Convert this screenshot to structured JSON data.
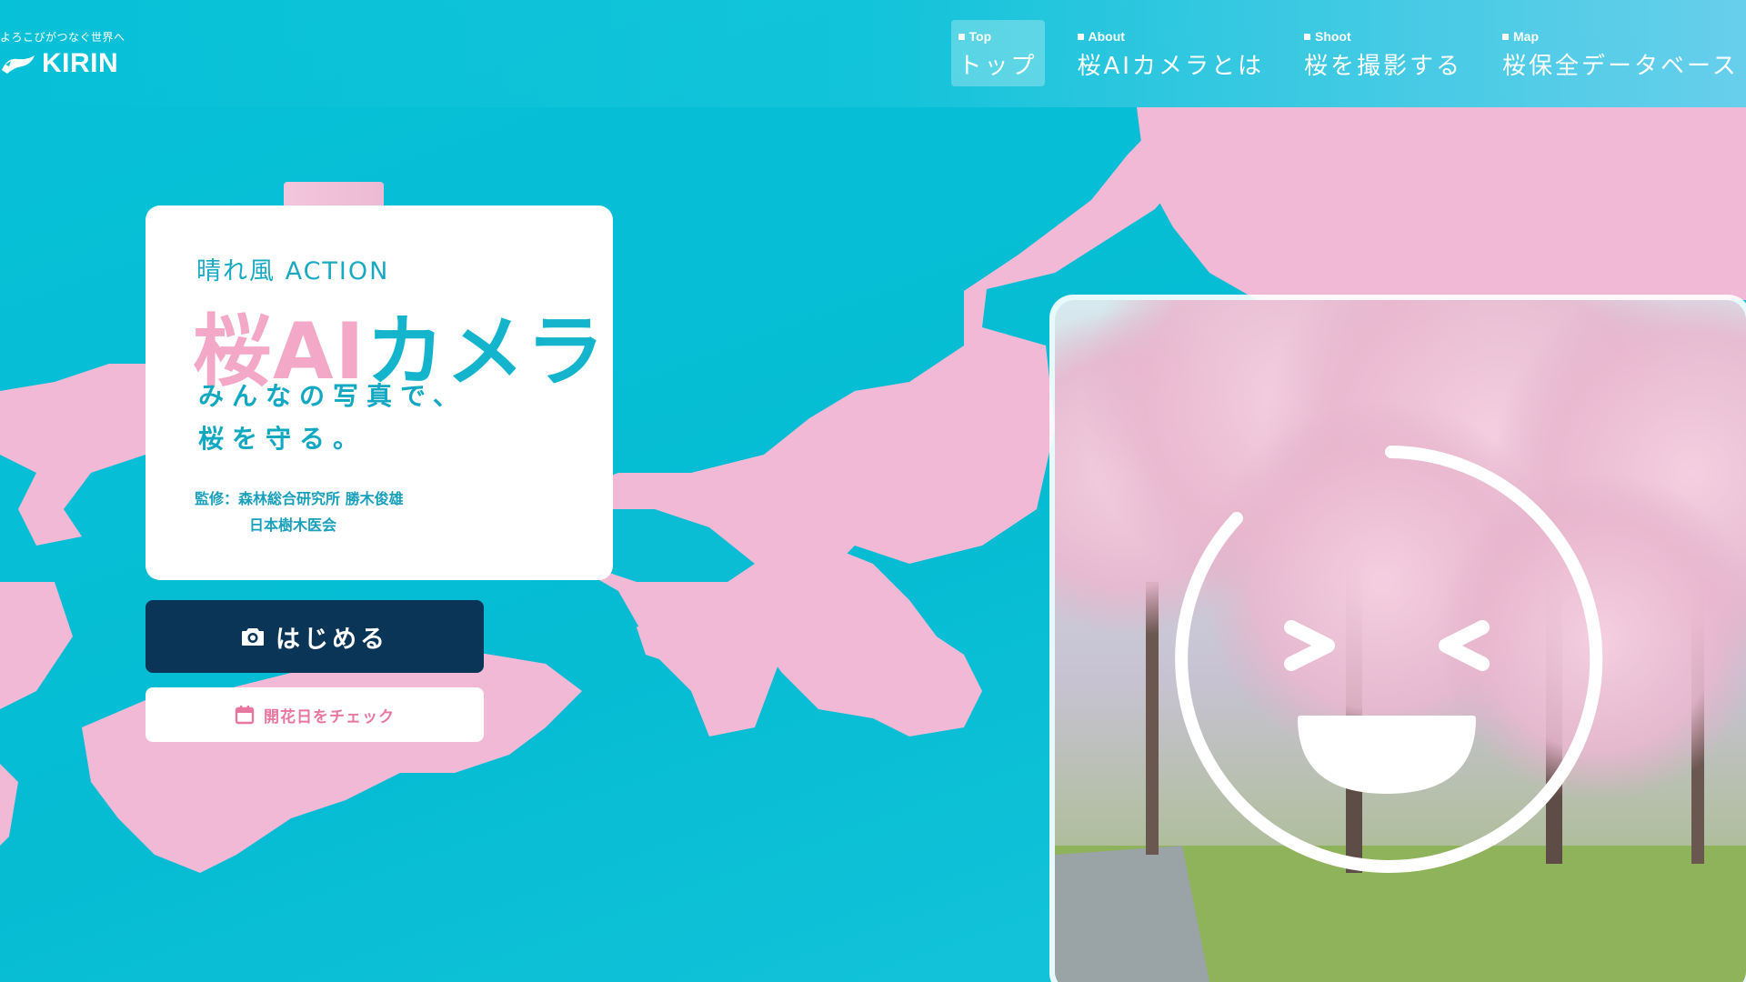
{
  "header": {
    "tagline": "よろこびがつなぐ世界へ",
    "brand": "KIRIN"
  },
  "nav": [
    {
      "en": "Top",
      "ja": "トップ",
      "active": true
    },
    {
      "en": "About",
      "ja": "桜AIカメラとは"
    },
    {
      "en": "Shoot",
      "ja": "桜を撮影する"
    },
    {
      "en": "Map",
      "ja": "桜保全データベース"
    }
  ],
  "hero": {
    "kicker": "晴れ風 ACTION",
    "title_part1": "桜AI",
    "title_part2": "カメラ",
    "tagline_line1": "みんなの写真で、",
    "tagline_line2": "桜を守る。",
    "supervisor_line1": "監修：森林総合研究所 勝木俊雄",
    "supervisor_line2": "日本樹木医会"
  },
  "actions": {
    "start_label": "はじめる",
    "bloom_label": "開花日をチェック"
  },
  "colors": {
    "sea": "#07c1d8",
    "land": "#f2b9d6",
    "navy": "#0b3556",
    "accent_pink": "#e8779f",
    "accent_cyan": "#14b5cc"
  },
  "icons": {
    "logo": "kirin-logo-icon",
    "camera": "camera-icon",
    "calendar": "calendar-icon",
    "face": "smiley-face-icon"
  }
}
